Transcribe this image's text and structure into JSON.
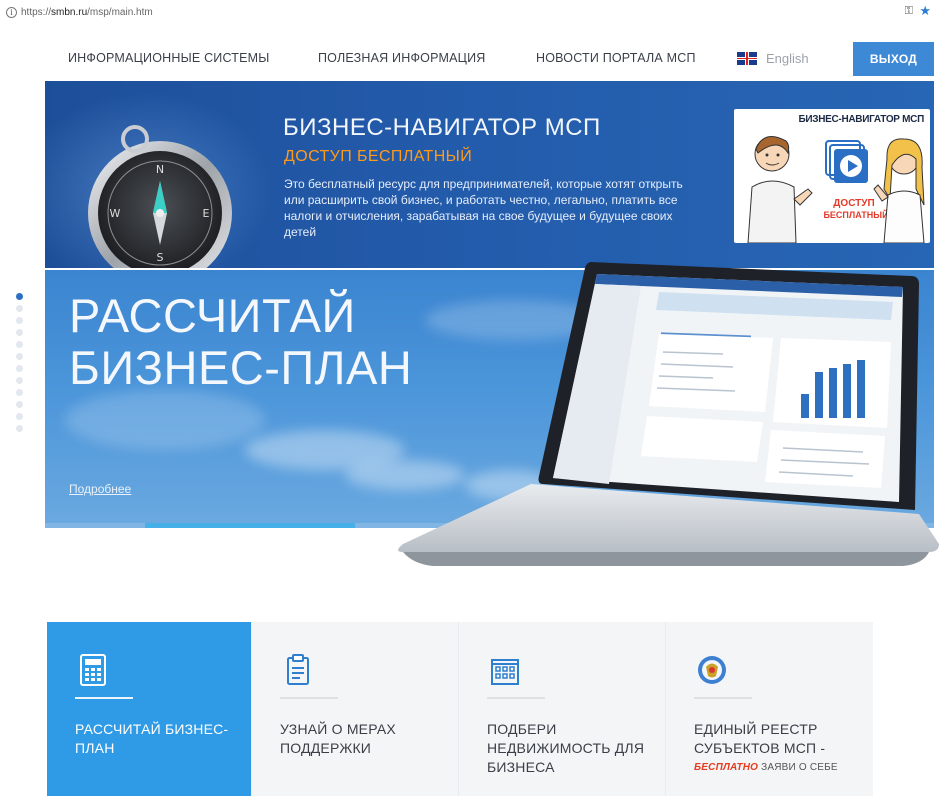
{
  "browser": {
    "url_prefix": "https://",
    "url_host": "smbn.ru",
    "url_path": "/msp/main.htm"
  },
  "nav": {
    "items": [
      {
        "label": "ИНФОРМАЦИОННЫЕ СИСТЕМЫ"
      },
      {
        "label": "ПОЛЕЗНАЯ ИНФОРМАЦИЯ"
      },
      {
        "label": "НОВОСТИ ПОРТАЛА МСП"
      }
    ],
    "language": "English",
    "exit_label": "ВЫХОД"
  },
  "banner_navigator": {
    "title": "БИЗНЕС-НАВИГАТОР МСП",
    "subtitle": "ДОСТУП БЕСПЛАТНЫЙ",
    "text": "Это бесплатный ресурс для предпринимателей, которые хотят открыть или расширить свой бизнес, и работать честно, легально, платить все налоги и отчисления, зарабатывая на свое будущее и будущее своих детей",
    "video": {
      "title": "БИЗНЕС-НАВИГАТОР МСП",
      "caption_line1": "ДОСТУП",
      "caption_line2": "БЕСПЛАТНЫЙ"
    }
  },
  "slider": {
    "title_line1": "РАССЧИТАЙ",
    "title_line2": "БИЗНЕС-ПЛАН",
    "more_link": "Подробнее",
    "slide_count": 13,
    "active_slide": 1
  },
  "tiles": [
    {
      "label": "РАССЧИТАЙ БИЗНЕС-ПЛАН",
      "icon": "calculator-icon",
      "active": true
    },
    {
      "label": "УЗНАЙ О МЕРАХ ПОДДЕРЖКИ",
      "icon": "clipboard-icon",
      "active": false
    },
    {
      "label": "ПОДБЕРИ НЕДВИЖИМОСТЬ ДЛЯ БИЗНЕСА",
      "icon": "building-icon",
      "active": false
    },
    {
      "label": "ЕДИНЫЙ РЕЕСТР СУБЪЕКТОВ МСП -",
      "note_highlight": "БЕСПЛАТНО",
      "note_rest": " ЗАЯВИ О СЕБЕ",
      "icon": "fns-emblem-icon",
      "active": false
    }
  ],
  "colors": {
    "accent": "#3d89d6",
    "tile_active": "#2f9be6",
    "orange": "#ff9a1a",
    "navy": "#1d4f99"
  }
}
